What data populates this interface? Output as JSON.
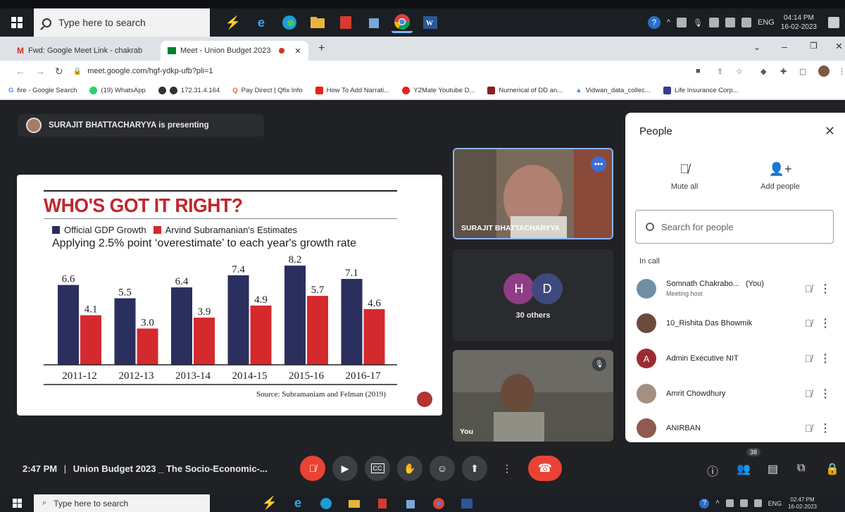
{
  "taskbar_top": {
    "search_placeholder": "Type here to search",
    "language": "ENG",
    "time": "04:14 PM",
    "date": "16-02-2023"
  },
  "taskbar_bottom": {
    "search_placeholder": "Type here to search",
    "language": "ENG",
    "time": "02:47 PM",
    "date": "16-02-2023"
  },
  "browser": {
    "tabs": [
      {
        "label": "Fwd: Google Meet Link - chakrab"
      },
      {
        "label": "Meet - Union Budget 2023"
      }
    ],
    "url": "meet.google.com/hgf-ydkp-ufb?pli=1",
    "bookmarks": [
      "fire - Google Search",
      "(19) WhatsApp",
      "172.31.4.164",
      "Pay Direct | Qfix Info",
      "How To Add Narrati...",
      "Y2Mate Youtube D...",
      "Numerical of DD an...",
      "Vidwan_data_collec...",
      "Life Insurance Corp..."
    ]
  },
  "meet": {
    "presenting_text": "SURAJIT BHATTACHARYYA is presenting",
    "slide": {
      "title": "WHO'S GOT IT RIGHT?",
      "legend": [
        "Official GDP Growth",
        "Arvind Subramanian's Estimates"
      ],
      "subtitle": "Applying 2.5% point ‘overestimate’ to each year's growth rate",
      "source": "Source: Subramaniam and Felman (2019)"
    },
    "tiles": {
      "presenter_name": "SURAJIT BHATTACHARYYA",
      "others_initials": [
        "H",
        "D"
      ],
      "others_count": "30 others",
      "self_name": "You"
    },
    "people": {
      "title": "People",
      "mute_all": "Mute all",
      "add_people": "Add people",
      "search_placeholder": "Search for people",
      "in_call": "In call",
      "participants": [
        {
          "name": "Somnath Chakrabo...",
          "tag": "(You)",
          "role": "Meeting host"
        },
        {
          "name": "10_Rishita Das Bhowmik",
          "tag": "",
          "role": ""
        },
        {
          "name": "Admin Executive NIT",
          "tag": "",
          "role": "",
          "initial": "A"
        },
        {
          "name": "Amrit Chowdhury",
          "tag": "",
          "role": ""
        },
        {
          "name": "ANIRBAN",
          "tag": "",
          "role": ""
        }
      ]
    },
    "controls": {
      "time": "2:47 PM",
      "separator": "|",
      "meeting_name": "Union Budget 2023 _ The Socio-Economic-...",
      "participant_count": "38"
    }
  },
  "chart_data": {
    "type": "bar",
    "title": "WHO'S GOT IT RIGHT?",
    "subtitle": "Applying 2.5% point ‘overestimate’ to each year's growth rate",
    "categories": [
      "2011-12",
      "2012-13",
      "2013-14",
      "2014-15",
      "2015-16",
      "2016-17"
    ],
    "series": [
      {
        "name": "Official GDP Growth",
        "values": [
          6.6,
          5.5,
          6.4,
          7.4,
          8.2,
          7.1
        ],
        "color": "#2a2f5e"
      },
      {
        "name": "Arvind Subramanian's Estimates",
        "values": [
          4.1,
          3.0,
          3.9,
          4.9,
          5.7,
          4.6
        ],
        "color": "#d42a2e"
      }
    ],
    "ylim": [
      0,
      8.5
    ],
    "grid": false,
    "legend": "top-left"
  }
}
